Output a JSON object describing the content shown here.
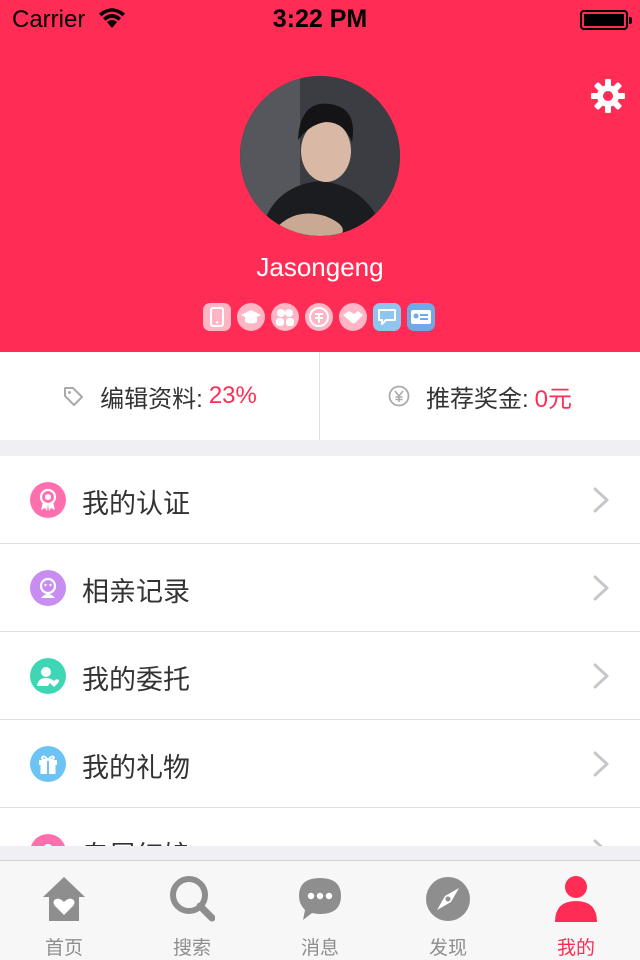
{
  "status_bar": {
    "carrier": "Carrier",
    "time": "3:22 PM"
  },
  "profile": {
    "username": "Jasongeng",
    "badges": [
      "phone-badge-icon",
      "education-badge-icon",
      "marriage-badge-icon",
      "income-badge-icon",
      "handshake-badge-icon",
      "chat-badge-icon",
      "id-card-badge-icon"
    ]
  },
  "stats": {
    "edit_profile_label": "编辑资料:",
    "edit_profile_value": "23%",
    "referral_bonus_label": "推荐奖金:",
    "referral_bonus_value": "0元"
  },
  "menu": {
    "items": [
      {
        "label": "我的认证",
        "icon": "certification-icon",
        "color": "#ff6fae"
      },
      {
        "label": "相亲记录",
        "icon": "dating-record-icon",
        "color": "#c78df0"
      },
      {
        "label": "我的委托",
        "icon": "delegation-icon",
        "color": "#3fd6b6"
      },
      {
        "label": "我的礼物",
        "icon": "gift-icon",
        "color": "#6cc4f4"
      },
      {
        "label": "专属红娘",
        "icon": "matchmaker-icon",
        "color": "#ff6fae"
      }
    ]
  },
  "tabs": [
    {
      "label": "首页",
      "icon": "home-icon"
    },
    {
      "label": "搜索",
      "icon": "search-icon"
    },
    {
      "label": "消息",
      "icon": "message-icon"
    },
    {
      "label": "发现",
      "icon": "compass-icon"
    },
    {
      "label": "我的",
      "icon": "person-icon",
      "active": true
    }
  ],
  "colors": {
    "accent": "#ff2d55",
    "tab_inactive": "#8e8e8e"
  }
}
